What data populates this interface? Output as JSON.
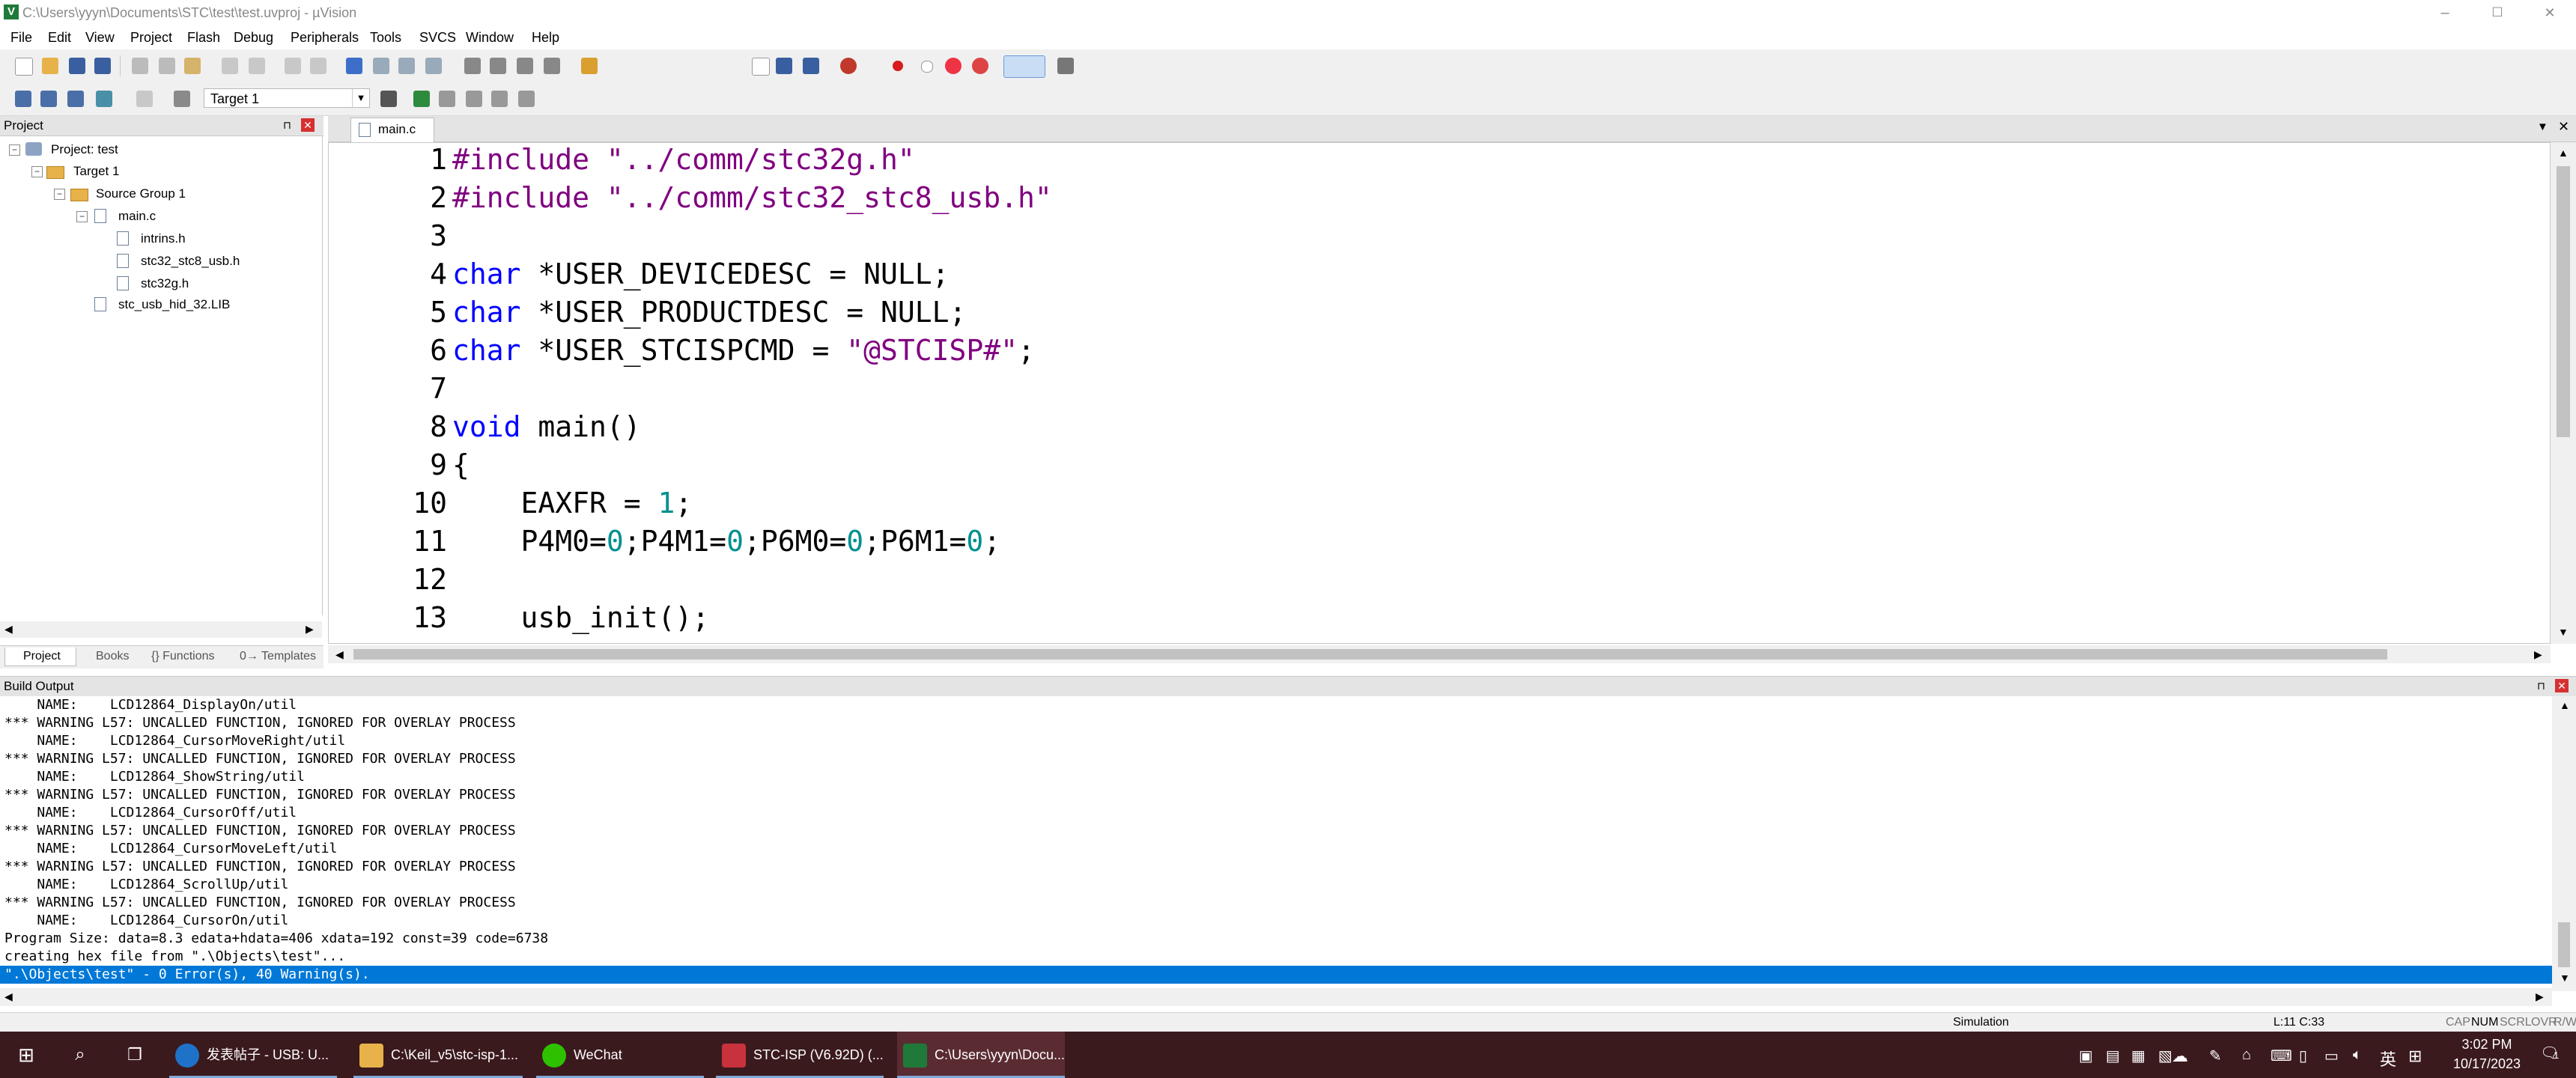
{
  "window": {
    "title": "C:\\Users\\yyyn\\Documents\\STC\\test\\test.uvproj - µVision",
    "app_icon": "V",
    "minimize": "–",
    "maximize": "☐",
    "close": "✕"
  },
  "menu": [
    "File",
    "Edit",
    "View",
    "Project",
    "Flash",
    "Debug",
    "Peripherals",
    "Tools",
    "SVCS",
    "Window",
    "Help"
  ],
  "toolbar": {
    "target": "Target 1"
  },
  "project_panel": {
    "title": "Project",
    "tree": {
      "root": "Project: test",
      "target": "Target 1",
      "group": "Source Group 1",
      "file": "main.c",
      "includes": [
        "intrins.h",
        "stc32_stc8_usb.h",
        "stc32g.h"
      ],
      "lib": "stc_usb_hid_32.LIB"
    },
    "tabs": [
      "Project",
      "Books",
      "{} Functions",
      "0→ Templates"
    ]
  },
  "editor": {
    "tab": "main.c",
    "lines": [
      {
        "n": "1",
        "segs": [
          {
            "t": "#include ",
            "c": "pp"
          },
          {
            "t": "\"../comm/stc32g.h\"",
            "c": "str"
          }
        ]
      },
      {
        "n": "2",
        "segs": [
          {
            "t": "#include ",
            "c": "pp"
          },
          {
            "t": "\"../comm/stc32_stc8_usb.h\"",
            "c": "str"
          }
        ]
      },
      {
        "n": "3",
        "segs": []
      },
      {
        "n": "4",
        "segs": [
          {
            "t": "char",
            "c": "kw"
          },
          {
            "t": " *USER_DEVICEDESC = NULL;",
            "c": "pl"
          }
        ]
      },
      {
        "n": "5",
        "segs": [
          {
            "t": "char",
            "c": "kw"
          },
          {
            "t": " *USER_PRODUCTDESC = NULL;",
            "c": "pl"
          }
        ]
      },
      {
        "n": "6",
        "segs": [
          {
            "t": "char",
            "c": "kw"
          },
          {
            "t": " *USER_STCISPCMD = ",
            "c": "pl"
          },
          {
            "t": "\"@STCISP#\"",
            "c": "str"
          },
          {
            "t": ";",
            "c": "pl"
          }
        ]
      },
      {
        "n": "7",
        "segs": []
      },
      {
        "n": "8",
        "segs": [
          {
            "t": "void",
            "c": "kw"
          },
          {
            "t": " main()",
            "c": "pl"
          }
        ]
      },
      {
        "n": "9",
        "segs": [
          {
            "t": "{",
            "c": "pl"
          }
        ]
      },
      {
        "n": "10",
        "segs": [
          {
            "t": "    EAXFR = ",
            "c": "pl"
          },
          {
            "t": "1",
            "c": "num"
          },
          {
            "t": ";",
            "c": "pl"
          }
        ]
      },
      {
        "n": "11",
        "segs": [
          {
            "t": "    P4M0=",
            "c": "pl"
          },
          {
            "t": "0",
            "c": "num"
          },
          {
            "t": ";P4M1=",
            "c": "pl"
          },
          {
            "t": "0",
            "c": "num"
          },
          {
            "t": ";P6M0=",
            "c": "pl"
          },
          {
            "t": "0",
            "c": "num"
          },
          {
            "t": ";P6M1=",
            "c": "pl"
          },
          {
            "t": "0",
            "c": "num"
          },
          {
            "t": ";",
            "c": "pl"
          }
        ]
      },
      {
        "n": "12",
        "segs": []
      },
      {
        "n": "13",
        "segs": [
          {
            "t": "    usb_init();",
            "c": "pl"
          }
        ]
      }
    ]
  },
  "build_output": {
    "title": "Build Output",
    "lines": [
      "    NAME:    LCD12864_DisplayOn/util",
      "*** WARNING L57: UNCALLED FUNCTION, IGNORED FOR OVERLAY PROCESS",
      "    NAME:    LCD12864_CursorMoveRight/util",
      "*** WARNING L57: UNCALLED FUNCTION, IGNORED FOR OVERLAY PROCESS",
      "    NAME:    LCD12864_ShowString/util",
      "*** WARNING L57: UNCALLED FUNCTION, IGNORED FOR OVERLAY PROCESS",
      "    NAME:    LCD12864_CursorOff/util",
      "*** WARNING L57: UNCALLED FUNCTION, IGNORED FOR OVERLAY PROCESS",
      "    NAME:    LCD12864_CursorMoveLeft/util",
      "*** WARNING L57: UNCALLED FUNCTION, IGNORED FOR OVERLAY PROCESS",
      "    NAME:    LCD12864_ScrollUp/util",
      "*** WARNING L57: UNCALLED FUNCTION, IGNORED FOR OVERLAY PROCESS",
      "    NAME:    LCD12864_CursorOn/util",
      "Program Size: data=8.3 edata+hdata=406 xdata=192 const=39 code=6738",
      "creating hex file from \".\\Objects\\test\"...",
      "\".\\Objects\\test\" - 0 Error(s), 40 Warning(s)."
    ]
  },
  "status": {
    "mode": "Simulation",
    "position": "L:11 C:33",
    "flags": [
      "CAP",
      "NUM",
      "SCRL",
      "OVR",
      "R/W"
    ]
  },
  "taskbar": {
    "apps": [
      {
        "label": "发表帖子 - USB: U...",
        "icon_color": "#1e73c8"
      },
      {
        "label": "C:\\Keil_v5\\stc-isp-1...",
        "icon_color": "#e8b24a"
      },
      {
        "label": "WeChat",
        "icon_color": "#2dc100"
      },
      {
        "label": "STC-ISP (V6.92D) (...",
        "icon_color": "#c8323c"
      },
      {
        "label": "C:\\Users\\yyyn\\Docu...",
        "icon_color": "#1f7a3a"
      }
    ],
    "ime": "英",
    "time": "3:02 PM",
    "date": "10/17/2023",
    "notifications": "1"
  }
}
